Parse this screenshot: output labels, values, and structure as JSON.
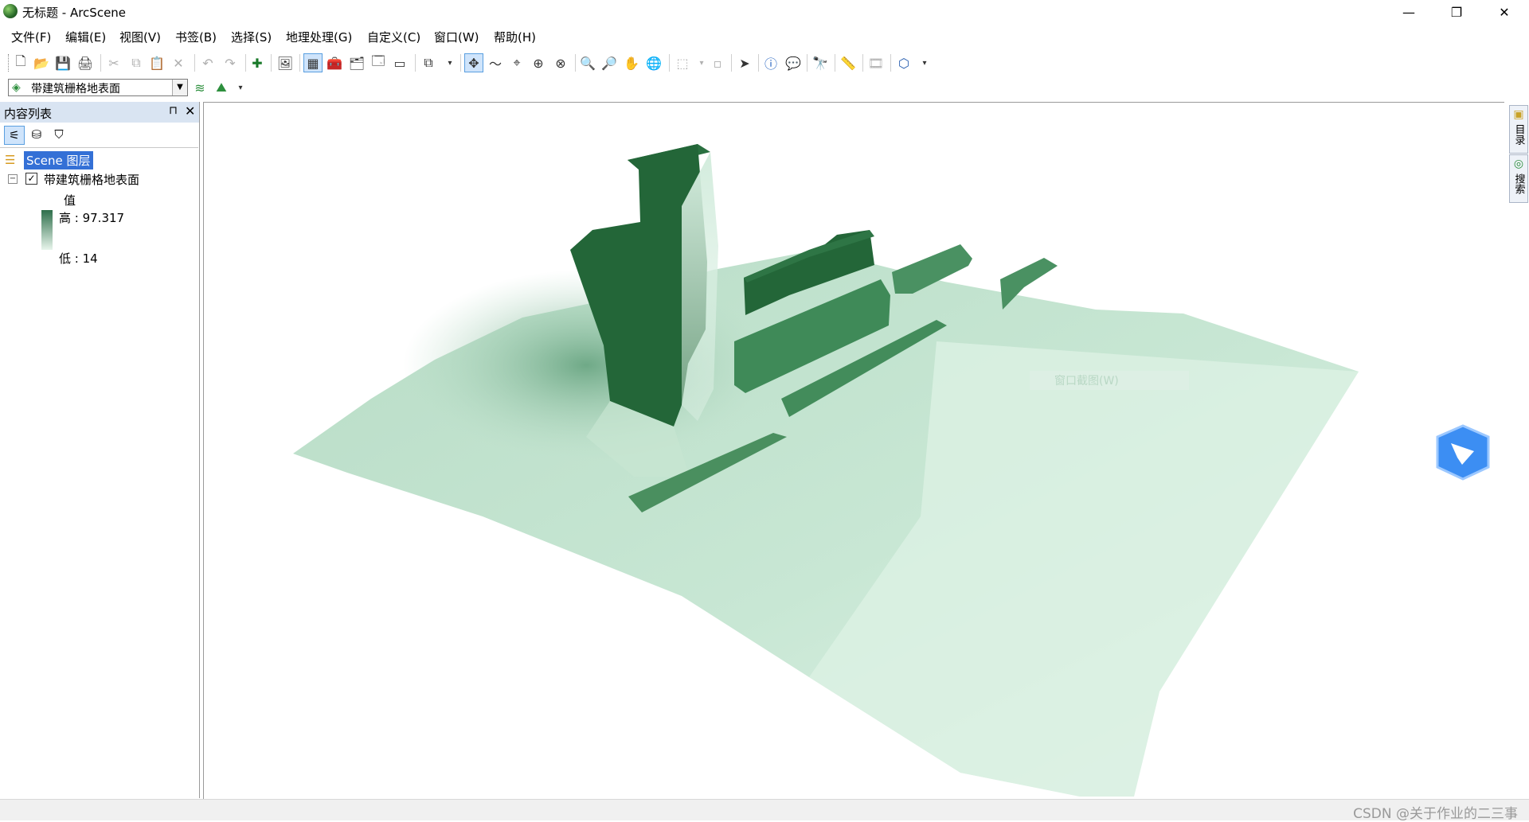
{
  "window": {
    "title": "无标题 - ArcScene",
    "minimize_glyph": "—",
    "restore_glyph": "❐",
    "close_glyph": "✕"
  },
  "menu": [
    "文件(F)",
    "编辑(E)",
    "视图(V)",
    "书签(B)",
    "选择(S)",
    "地理处理(G)",
    "自定义(C)",
    "窗口(W)",
    "帮助(H)"
  ],
  "toolbar": {
    "layer_combo_value": "带建筑栅格地表面",
    "icons": [
      "new-icon",
      "open-icon",
      "save-icon",
      "print-icon",
      "cut-icon",
      "copy-icon",
      "paste-icon",
      "delete-icon",
      "undo-icon",
      "redo-icon",
      "add-data-icon",
      "export-icon",
      "attribute-table-icon",
      "toolbox-icon",
      "catalog-icon",
      "scene-properties-icon",
      "navigate-icon",
      "fly-icon",
      "center-target-icon",
      "zoom-target-icon",
      "set-observer-icon",
      "zoom-in-icon",
      "zoom-out-icon",
      "pan-icon",
      "full-extent-icon",
      "select-features-icon",
      "select-arrow-icon",
      "identify-icon",
      "html-popup-icon",
      "find-icon",
      "measure-icon",
      "animation-icon",
      "3d-effects-icon"
    ]
  },
  "toc": {
    "title": "内容列表",
    "pin_glyph": "⊓",
    "close_glyph": "✕",
    "scene_label": "Scene 图层",
    "layer_name": "带建筑栅格地表面",
    "checked_glyph": "✓",
    "expander_glyph": "−",
    "legend_title": "值",
    "high_label": "高 : 97.317",
    "low_label": "低 : 14"
  },
  "scene": {
    "ghost_menu_text": "窗口截图(W)",
    "colors": {
      "building_dark": "#236638",
      "building_mid": "#3f8a58",
      "ground_light": "#e0f3e8",
      "ground_mid": "#a9d4bb",
      "ground_dark": "#6da884"
    }
  },
  "side_tabs": [
    "目录",
    "搜索"
  ],
  "status": {
    "watermark": "CSDN @关于作业的二三事"
  }
}
